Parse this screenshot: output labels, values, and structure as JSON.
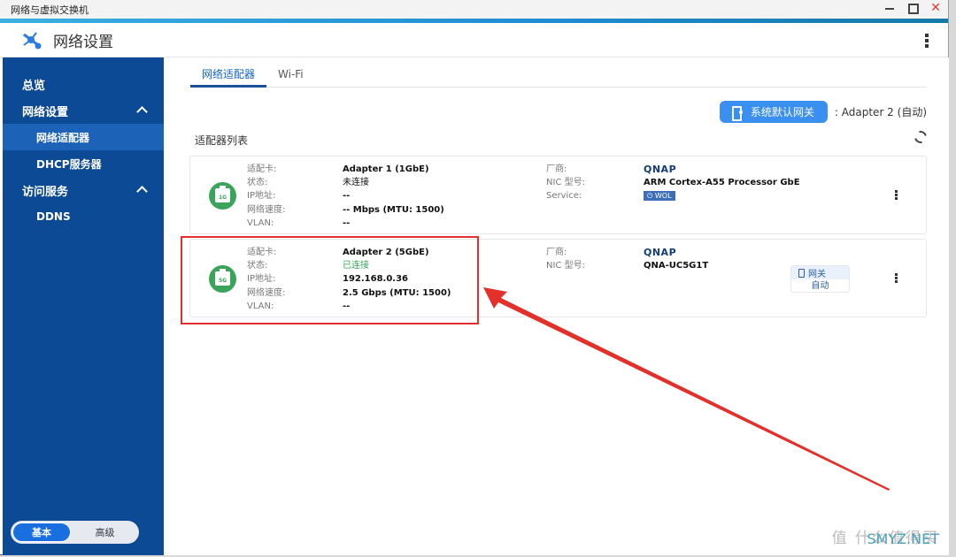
{
  "window": {
    "title": "网络与虚拟交换机",
    "controls": {
      "minimize": "minimize-icon",
      "maximize": "maximize-icon",
      "close": "close-icon"
    }
  },
  "app": {
    "title": "网络设置",
    "icon": "network-nodes-icon",
    "menu_icon": "kebab-menu-icon"
  },
  "sidebar": {
    "items": [
      {
        "label": "总览",
        "type": "section"
      },
      {
        "label": "网络设置",
        "type": "section",
        "expanded": true
      },
      {
        "label": "网络适配器",
        "type": "sub",
        "active": true
      },
      {
        "label": "DHCP服务器",
        "type": "sub"
      },
      {
        "label": "访问服务",
        "type": "section",
        "expanded": true
      },
      {
        "label": "DDNS",
        "type": "sub"
      }
    ],
    "mode": {
      "basic": "基本",
      "advanced": "高级",
      "selected": "基本"
    }
  },
  "tabs": [
    {
      "label": "网络适配器",
      "active": true
    },
    {
      "label": "Wi-Fi",
      "active": false
    }
  ],
  "gateway": {
    "button_label": "系统默认网关",
    "value": ": Adapter 2 (自动)"
  },
  "list": {
    "title": "适配器列表",
    "refresh_icon": "refresh-icon"
  },
  "labels": {
    "adapter": "适配卡:",
    "status": "状态:",
    "ip": "IP地址:",
    "speed": "网络速度:",
    "vlan": "VLAN:",
    "vendor": "厂商:",
    "nic": "NIC 型号:",
    "service": "Service:"
  },
  "adapters": [
    {
      "badge": "1G",
      "name": "Adapter 1 (1GbE)",
      "status": "未连接",
      "connected": false,
      "ip": "--",
      "speed": "-- Mbps (MTU: 1500)",
      "vlan": "--",
      "vendor": "QNAP",
      "nic": "ARM Cortex-A55 Processor GbE",
      "service": "WOL"
    },
    {
      "badge": "5G",
      "name": "Adapter 2 (5GbE)",
      "status": "已连接",
      "connected": true,
      "ip": "192.168.0.36",
      "speed": "2.5 Gbps (MTU: 1500)",
      "vlan": "--",
      "vendor": "QNAP",
      "nic": "QNA-UC5G1T",
      "gateway_chip": {
        "top": "网关",
        "bottom": "自动"
      }
    }
  ],
  "annotation": {
    "color": "#e3302b"
  },
  "watermark": {
    "text": "值 什么值得买",
    "site": "SMYZ.NET"
  },
  "colors": {
    "sidebar": "#0d4a96",
    "sidebar_active": "#1c63b8",
    "accent": "#3b8ff0",
    "connected": "#3aa55a"
  }
}
